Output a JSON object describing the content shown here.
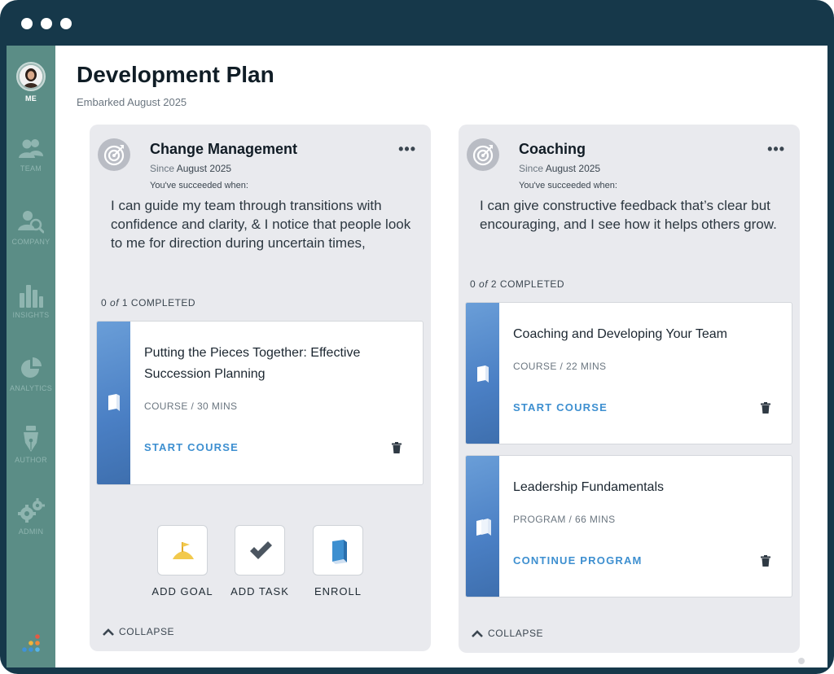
{
  "app": {
    "title": "Development Plan",
    "subtitle": "Embarked August 2025"
  },
  "sidebar": {
    "items": [
      {
        "label": "ME",
        "icon": "avatar"
      },
      {
        "label": "TEAM",
        "icon": "team-icon"
      },
      {
        "label": "COMPANY",
        "icon": "company-search-icon"
      },
      {
        "label": "INSIGHTS",
        "icon": "bar-chart-icon"
      },
      {
        "label": "ANALYTICS",
        "icon": "pie-chart-icon"
      },
      {
        "label": "AUTHOR",
        "icon": "pen-nib-icon"
      },
      {
        "label": "ADMIN",
        "icon": "gears-icon"
      }
    ],
    "active": "ME"
  },
  "goals": [
    {
      "title": "Change Management",
      "since_prefix": "Since",
      "since_date": "August 2025",
      "success_label": "You've succeeded when:",
      "description": "I can guide my team through transitions with confidence and clarity, & I notice that people look to me for direction during uncertain times,",
      "progress": {
        "done": "0",
        "of": "of",
        "total": "1",
        "suffix": "COMPLETED"
      },
      "courses": [
        {
          "title": "Putting the Pieces Together: Effective Succession Planning",
          "meta": "COURSE / 30 MINS",
          "action": "START COURSE"
        }
      ],
      "actions": [
        {
          "label": "ADD GOAL",
          "icon": "flag-icon"
        },
        {
          "label": "ADD TASK",
          "icon": "checkmark-icon"
        },
        {
          "label": "ENROLL",
          "icon": "book-icon"
        }
      ],
      "collapse_label": "COLLAPSE"
    },
    {
      "title": "Coaching",
      "since_prefix": "Since",
      "since_date": "August 2025",
      "success_label": "You've succeeded when:",
      "description": "I can give constructive feedback that’s clear but encouraging, and I see how it helps others grow.",
      "progress": {
        "done": "0",
        "of": "of",
        "total": "2",
        "suffix": "COMPLETED"
      },
      "courses": [
        {
          "title": "Coaching and Developing Your Team",
          "meta": "COURSE / 22 MINS",
          "action": "START COURSE"
        },
        {
          "title": "Leadership Fundamentals",
          "meta": "PROGRAM / 66 MINS",
          "action": "CONTINUE PROGRAM"
        }
      ],
      "collapse_label": "COLLAPSE"
    }
  ],
  "colors": {
    "frame": "#16384a",
    "sidebar": "#5b8d86",
    "card_bg": "#e9eaee",
    "link": "#3d8fd0",
    "thumb": "#4a7fc4"
  }
}
